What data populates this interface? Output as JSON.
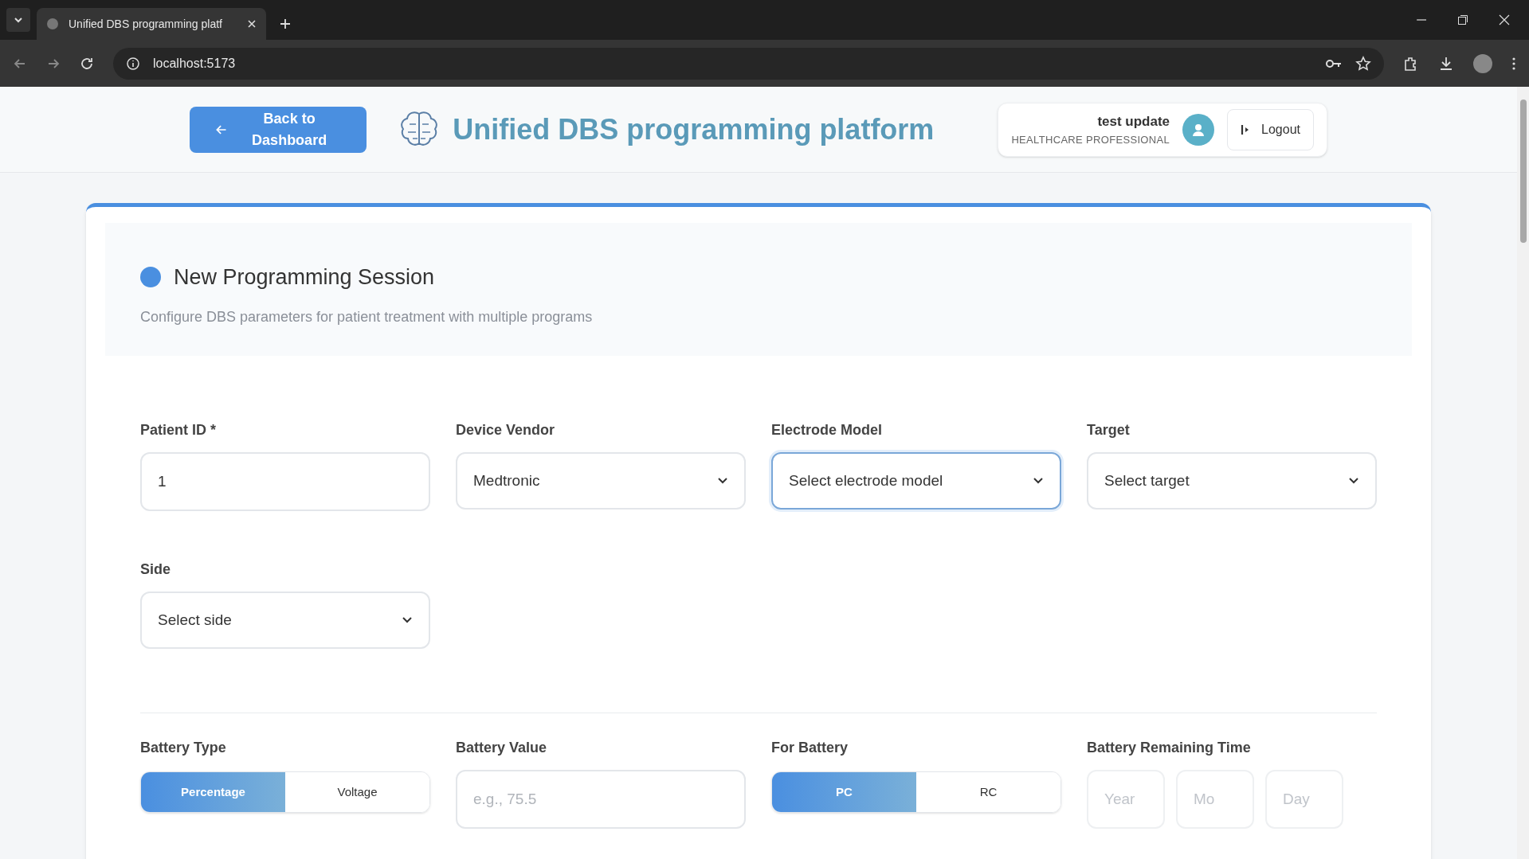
{
  "browser": {
    "tab_title": "Unified DBS programming platf",
    "url": "localhost:5173"
  },
  "header": {
    "back_button": "Back to Dashboard",
    "title": "Unified DBS programming platform",
    "user_name": "test update",
    "user_role": "HEALTHCARE PROFESSIONAL",
    "logout": "Logout"
  },
  "session": {
    "title": "New Programming Session",
    "subtitle": "Configure DBS parameters for patient treatment with multiple programs"
  },
  "fields": [
    {
      "kind": "input",
      "label": "Patient ID *",
      "value": "1"
    },
    {
      "kind": "select",
      "label": "Device Vendor",
      "value": "Medtronic",
      "focused": false
    },
    {
      "kind": "select",
      "label": "Electrode Model",
      "value": "Select electrode model",
      "focused": true
    },
    {
      "kind": "select",
      "label": "Target",
      "value": "Select target",
      "focused": false
    },
    {
      "kind": "select",
      "label": "Side",
      "value": "Select side",
      "focused": false
    }
  ],
  "battery": [
    {
      "kind": "toggle",
      "label": "Battery Type",
      "options": [
        {
          "label": "Percentage",
          "selected": true
        },
        {
          "label": "Voltage",
          "selected": false
        }
      ]
    },
    {
      "kind": "input",
      "label": "Battery Value",
      "placeholder": "e.g., 75.5"
    },
    {
      "kind": "toggle",
      "label": "For Battery",
      "options": [
        {
          "label": "PC",
          "selected": true
        },
        {
          "label": "RC",
          "selected": false
        }
      ]
    },
    {
      "kind": "time",
      "label": "Battery Remaining Time",
      "placeholders": [
        "Year",
        "Mo",
        "Day"
      ]
    }
  ]
}
